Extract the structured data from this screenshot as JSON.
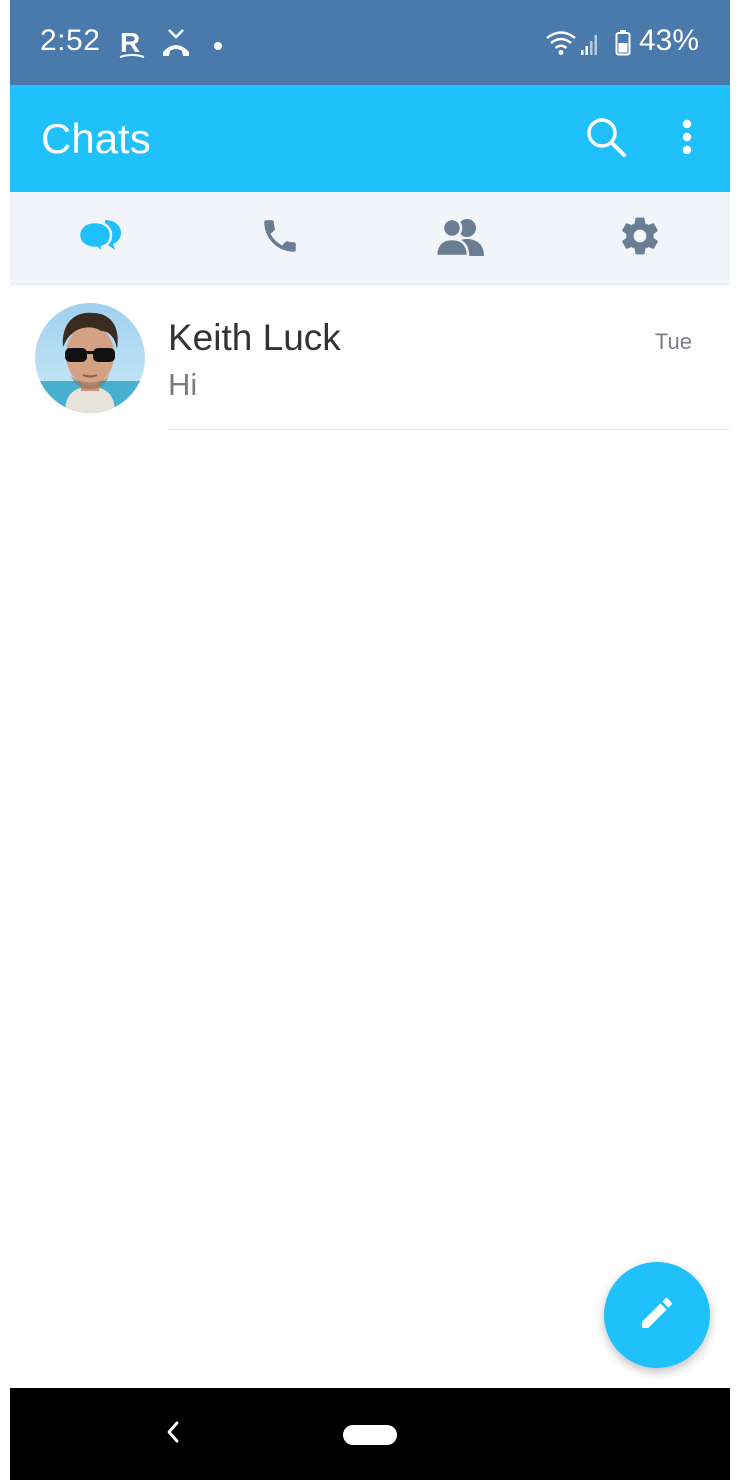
{
  "status_bar": {
    "time": "2:52",
    "battery": "43%",
    "icons": [
      "rakuten-icon",
      "missed-call-icon",
      "notification-dot-icon",
      "wifi-icon",
      "signal-icon",
      "battery-icon"
    ]
  },
  "app_bar": {
    "title": "Chats",
    "actions": [
      "search-icon",
      "more-vert-icon"
    ]
  },
  "tabs": [
    {
      "name": "chats",
      "icon": "chat-bubbles-icon",
      "active": true
    },
    {
      "name": "calls",
      "icon": "phone-icon",
      "active": false
    },
    {
      "name": "contacts",
      "icon": "people-icon",
      "active": false
    },
    {
      "name": "settings",
      "icon": "gear-icon",
      "active": false
    }
  ],
  "chats": [
    {
      "name": "Keith Luck",
      "last_message": "Hi",
      "time": "Tue"
    }
  ],
  "fab": {
    "icon": "pencil-icon"
  },
  "colors": {
    "status_bar": "#4a7aac",
    "app_bar": "#20c0fa",
    "tab_bar": "#f1f5f9",
    "tab_active": "#20c0fa",
    "tab_inactive": "#6b7d92",
    "fab": "#20c0fa"
  }
}
